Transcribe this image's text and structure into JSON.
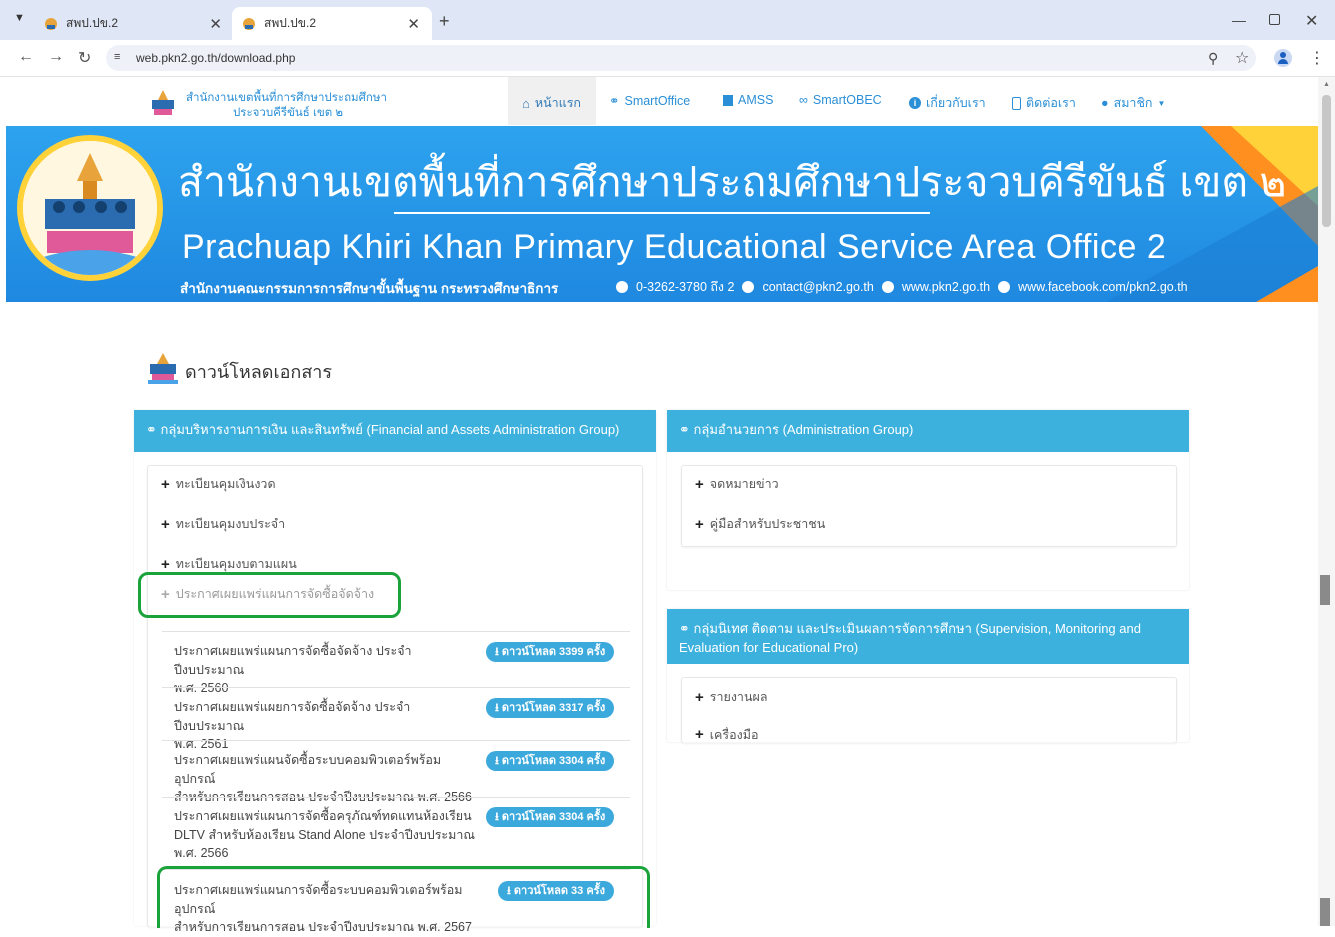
{
  "browser": {
    "tabs": [
      {
        "title": "สพป.ปข.2",
        "active": false
      },
      {
        "title": "สพป.ปข.2",
        "active": true
      }
    ],
    "new_tab": "+",
    "url": "web.pkn2.go.th/download.php",
    "window_controls": [
      "minimize-icon",
      "restore-icon",
      "close-icon"
    ]
  },
  "site": {
    "logo_line1": "สำนักงานเขตพื้นที่การศึกษาประถมศึกษา",
    "logo_line2": "ประจวบคีรีขันธ์ เขต ๒",
    "nav": [
      {
        "label": "หน้าแรก",
        "icon": "home-icon",
        "active": true
      },
      {
        "label": "SmartOffice",
        "icon": "paperclip-icon"
      },
      {
        "label": "AMSS",
        "icon": "book-icon"
      },
      {
        "label": "SmartOBEC",
        "icon": "link-icon"
      },
      {
        "label": "เกี่ยวกับเรา",
        "icon": "info-icon"
      },
      {
        "label": "ติดต่อเรา",
        "icon": "phone-icon"
      },
      {
        "label": "สมาชิก",
        "icon": "user-icon"
      }
    ]
  },
  "banner": {
    "title_th": "สำนักงานเขตพื้นที่การศึกษาประถมศึกษาประจวบคีรีขันธ์ เขต ๒",
    "title_en": "Prachuap Khiri Khan Primary Educational Service Area Office 2",
    "subtitle": "สำนักงานคณะกรรมการการศึกษาขั้นพื้นฐาน กระทรวงศึกษาธิการ",
    "phone": "0-3262-3780 ถึง 2",
    "email": "contact@pkn2.go.th",
    "website": "www.pkn2.go.th",
    "facebook": "www.facebook.com/pkn2.go.th"
  },
  "page": {
    "heading": "ดาวน์โหลดเอกสาร",
    "finance_panel": {
      "title": "กลุ่มบริหารงานการเงิน และสินทรัพย์ (Financial and Assets Administration Group)",
      "items": [
        "ทะเบียนคุมเงินงวด",
        "ทะเบียนคุมงบประจำ",
        "ทะเบียนคุมงบตามแผน",
        "ประกาศเผยแพร่แผนการจัดซื้อจัดจ้าง"
      ],
      "documents": [
        {
          "line1": "ประกาศเผยแพร่แผนการจัดซื้อจัดจ้าง ประจำปีงบประมาณ",
          "line2": "พ.ศ. 2560",
          "line3": "",
          "download": "ดาวน์โหลด 3399 ครั้ง"
        },
        {
          "line1": "ประกาศเผยแพร่แผยการจัดซื้อจัดจ้าง ประจำปีงบประมาณ",
          "line2": "พ.ศ. 2561",
          "line3": "",
          "download": "ดาวน์โหลด 3317 ครั้ง"
        },
        {
          "line1": "ประกาศเผยแพร่แผนจัดซื้อระบบคอมพิวเตอร์พร้อมอุปกรณ์",
          "line2": "สำหรับการเรียนการสอน ประจำปีงบประมาณ พ.ศ. 2566",
          "line3": "",
          "download": "ดาวน์โหลด 3304 ครั้ง"
        },
        {
          "line1": "ประกาศเผยแพร่แผนการจัดซื้อครุภัณฑ์ทดแทนห้องเรียน",
          "line2": "DLTV สำหรับห้องเรียน Stand Alone ประจำปีงบประมาณ",
          "line3": "พ.ศ. 2566",
          "download": "ดาวน์โหลด 3304 ครั้ง"
        },
        {
          "line1": "ประกาศเผยแพร่แผนการจัดซื้อระบบคอมพิวเตอร์พร้อมอุปกรณ์",
          "line2": "สำหรับการเรียนการสอน ประจำปีงบประมาณ พ.ศ. 2567",
          "line3": "",
          "download": "ดาวน์โหลด 33 ครั้ง"
        }
      ]
    },
    "admin_panel": {
      "title": "กลุ่มอำนวยการ (Administration Group)",
      "items": [
        "จดหมายข่าว",
        "คู่มือสำหรับประชาชน"
      ]
    },
    "supervision_panel": {
      "title_line1": "กลุ่มนิเทศ ติดตาม และประเมินผลการจัดการศึกษา (Supervision, Monitoring and",
      "title_line2": "Evaluation for Educational Pro)",
      "items": [
        "รายงานผล",
        "เครื่องมือ"
      ]
    }
  },
  "colors": {
    "accent": "#3cb1de",
    "banner": "#1f88e0",
    "highlight": "#1aa33a",
    "tabstrip": "#dfe6f5"
  }
}
